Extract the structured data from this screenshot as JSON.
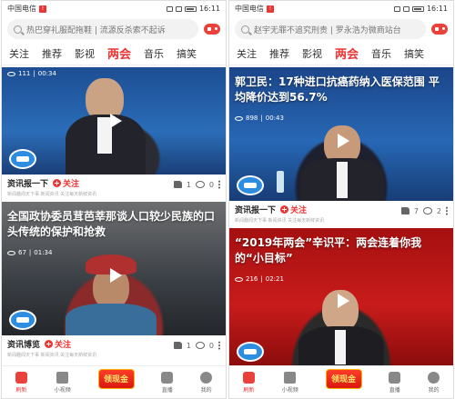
{
  "status": {
    "carrier": "中国电信",
    "time": "16:11"
  },
  "left": {
    "search_placeholder": "热巴穿礼服配拖鞋 | 流源反杀索不起诉",
    "tabs": [
      "关注",
      "推荐",
      "影视",
      "两会",
      "音乐",
      "搞笑"
    ],
    "active_tab": "两会",
    "cards": [
      {
        "views": "111",
        "duration": "00:34",
        "title": "",
        "channel": "资讯报一下",
        "follow": "关注",
        "subline": "新闻趣闻天下事 新闻资讯 关注每天新鲜资讯",
        "likes": "1",
        "comments": "0"
      },
      {
        "views": "67",
        "duration": "01:34",
        "title": "全国政协委员茸芭莘那谈人口较少民族的口头传统的保护和抢救",
        "channel": "资讯博览",
        "follow": "关注",
        "subline": "新闻趣闻天下事 新闻资讯 关注每天新鲜资讯",
        "likes": "1",
        "comments": "0"
      }
    ]
  },
  "right": {
    "search_placeholder": "赵宇无罪不追究刑责 | 罗永浩为微商站台",
    "tabs": [
      "关注",
      "推荐",
      "影视",
      "两会",
      "音乐",
      "搞笑"
    ],
    "active_tab": "两会",
    "cards": [
      {
        "views": "898",
        "duration": "00:43",
        "title": "郭卫民：17种进口抗癌药纳入医保范围 平均降价达到56.7%",
        "channel": "资讯报一下",
        "follow": "关注",
        "subline": "新闻趣闻天下事 新闻资讯 关注每天新鲜资讯",
        "likes": "7",
        "comments": "2"
      },
      {
        "views": "216",
        "duration": "02:21",
        "title": "“2019年两会”辛识平：两会连着你我的“小目标”",
        "channel": "",
        "follow": "",
        "subline": "",
        "likes": "",
        "comments": ""
      }
    ]
  },
  "nav": [
    {
      "label": "刷新",
      "icon": "refresh-icon"
    },
    {
      "label": "小视频",
      "icon": "short-video-icon"
    },
    {
      "label": "领现金",
      "icon": "cash-icon"
    },
    {
      "label": "直播",
      "icon": "live-icon"
    },
    {
      "label": "我的",
      "icon": "profile-icon"
    }
  ],
  "colors": {
    "accent": "#e33333",
    "video_left_1": "#1d4e93",
    "video_left_2": "#3a3f45",
    "video_right_1": "#1b4589",
    "video_right_2": "#b01212"
  }
}
